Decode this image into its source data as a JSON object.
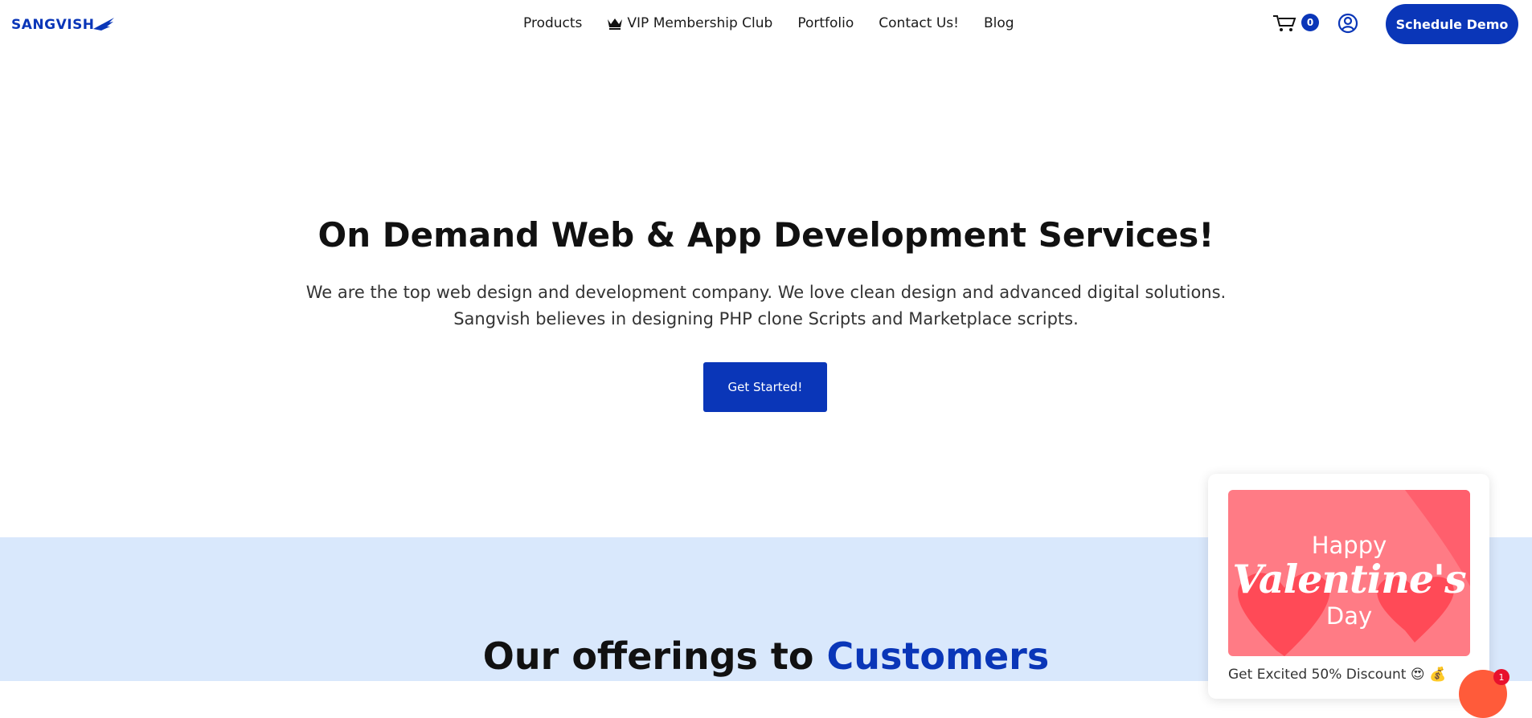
{
  "header": {
    "logo_text": "SANGVISH",
    "nav": [
      {
        "label": "Products"
      },
      {
        "label": "VIP Membership Club",
        "icon": "crown-icon"
      },
      {
        "label": "Portfolio"
      },
      {
        "label": "Contact Us!"
      },
      {
        "label": "Blog"
      }
    ],
    "cart_count": "0",
    "cart_icon": "cart-icon",
    "account_icon": "user-circle-icon",
    "cta_label": "Schedule Demo"
  },
  "hero": {
    "title": "On Demand Web & App Development Services!",
    "subtitle_line1": "We are the top web design and development company. We love clean design and advanced digital solutions.",
    "subtitle_line2": "Sangvish believes in designing PHP clone Scripts and Marketplace scripts.",
    "button_label": "Get Started!"
  },
  "offerings": {
    "title_prefix": "Our offerings to ",
    "title_accent": "Customers"
  },
  "promo": {
    "image_line1": "Happy",
    "image_line2": "Valentine's",
    "image_line3": "Day",
    "caption": "Get Excited 50% Discount 😍 💰"
  },
  "chat": {
    "badge_count": "1"
  },
  "colors": {
    "brand": "#0a36b8",
    "band": "#d9e8fc",
    "promo_bg": "#ff7b85",
    "chat": "#ff5b3a"
  }
}
